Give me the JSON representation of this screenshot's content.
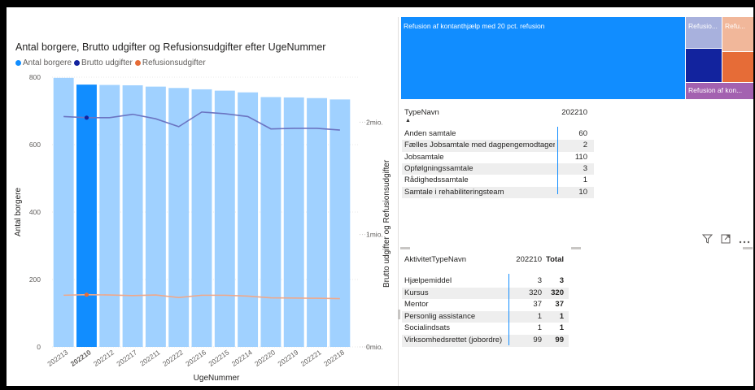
{
  "chart_data": [
    {
      "type": "bar-line-combo",
      "title": "Antal borgere, Brutto udgifter og Refusionsudgifter efter UgeNummer",
      "legend": [
        {
          "name": "Antal borgere",
          "color": "#118dff"
        },
        {
          "name": "Brutto udgifter",
          "color": "#12239e"
        },
        {
          "name": "Refusionsudgifter",
          "color": "#e66c37"
        }
      ],
      "legend_position": "top-left",
      "categories": [
        "202213",
        "202210",
        "202212",
        "202217",
        "202211",
        "202222",
        "202216",
        "202215",
        "202214",
        "202220",
        "202219",
        "202221",
        "202218"
      ],
      "highlighted_category": "202210",
      "series": [
        {
          "name": "Antal borgere",
          "kind": "bar",
          "axis": "left",
          "values": [
            798,
            778,
            777,
            776,
            772,
            768,
            764,
            760,
            755,
            741,
            740,
            738,
            734
          ]
        },
        {
          "name": "Brutto udgifter",
          "kind": "line",
          "axis": "right",
          "values": [
            2050000,
            2040000,
            2040000,
            2070000,
            2030000,
            1960000,
            2090000,
            2075000,
            2050000,
            1940000,
            1945000,
            1945000,
            1930000
          ]
        },
        {
          "name": "Refusionsudgifter",
          "kind": "line",
          "axis": "right",
          "values": [
            460000,
            465000,
            462000,
            457000,
            462000,
            440000,
            460000,
            460000,
            452000,
            437000,
            435000,
            433000,
            430000
          ]
        }
      ],
      "xlabel": "UgeNummer",
      "ylabel": "Antal borgere",
      "y2label": "Brutto udgifter og Refusionsudgifter",
      "ylim": [
        0,
        800
      ],
      "y2lim": [
        0,
        2400000
      ],
      "yticks": [
        "0",
        "200",
        "400",
        "600",
        "800"
      ],
      "y2ticks": [
        "0mio.",
        "1mio.",
        "2mio."
      ],
      "grid": true
    },
    {
      "type": "treemap",
      "items": [
        {
          "label": "Refusion af kontanthjælp med 20 pct. refusion",
          "color": "#118dff"
        },
        {
          "label": "Refusio...",
          "color": "#a8b1dd"
        },
        {
          "label": "",
          "color": "#12239e"
        },
        {
          "label": "Refu...",
          "color": "#f1b79a"
        },
        {
          "label": "",
          "color": "#e66c37"
        },
        {
          "label": "Refusion af kon...",
          "color": "#a361b0"
        }
      ]
    },
    {
      "type": "table",
      "columns": [
        "TypeNavn",
        "202210"
      ],
      "rows": [
        [
          "Anden samtale",
          "60"
        ],
        [
          "Fælles Jobsamtale med dagpengemodtager",
          "2"
        ],
        [
          "Jobsamtale",
          "110"
        ],
        [
          "Opfølgningssamtale",
          "3"
        ],
        [
          "Rådighedssamtale",
          "1"
        ],
        [
          "Samtale i rehabiliteringsteam",
          "10"
        ]
      ]
    },
    {
      "type": "table",
      "columns": [
        "AktivitetTypeNavn",
        "202210",
        "Total"
      ],
      "rows": [
        [
          "Hjælpemiddel",
          "3",
          "3"
        ],
        [
          "Kursus",
          "320",
          "320"
        ],
        [
          "Mentor",
          "37",
          "37"
        ],
        [
          "Personlig assistance",
          "1",
          "1"
        ],
        [
          "Socialindsats",
          "1",
          "1"
        ],
        [
          "Virksomhedsrettet (jobordre)",
          "99",
          "99"
        ]
      ]
    }
  ],
  "icons": {
    "filter": "filter-icon",
    "focus": "focus-mode-icon",
    "more": "more-options-icon"
  }
}
